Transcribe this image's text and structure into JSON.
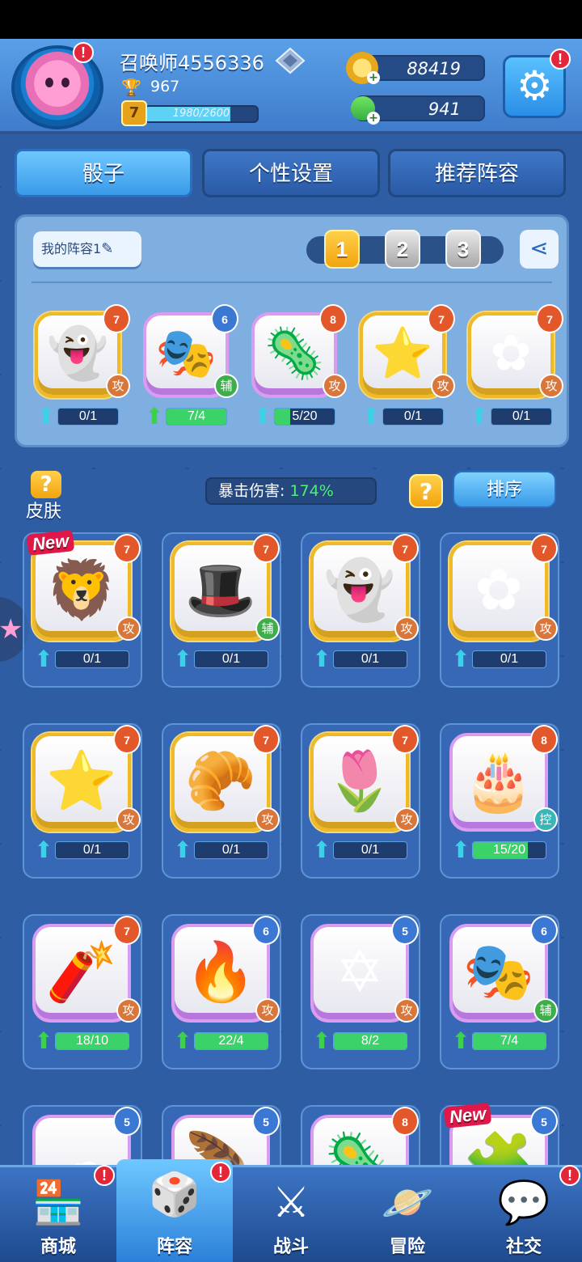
{
  "header": {
    "player_name": "召唤师4556336",
    "trophies": "967",
    "level": "7",
    "xp_text": "1980/2600",
    "xp_fraction": 0.76,
    "gold": "88419",
    "gems": "941",
    "badge": "!"
  },
  "tabs": [
    {
      "label": "骰子",
      "active": true
    },
    {
      "label": "个性设置",
      "active": false
    },
    {
      "label": "推荐阵容",
      "active": false
    }
  ],
  "deck": {
    "name": "我的阵容1",
    "slots": [
      "1",
      "2",
      "3"
    ],
    "active_slot": "1",
    "cards": [
      {
        "icon": "ghost-icon",
        "glyph": "👻",
        "level": "7",
        "level_color": "orange",
        "role": "攻",
        "role_type": "atk",
        "frame": "gold",
        "progress": "0/1",
        "fill": 0,
        "arrow": "cyan"
      },
      {
        "icon": "masks-icon",
        "glyph": "🎭",
        "level": "6",
        "level_color": "blue",
        "role": "辅",
        "role_type": "sup",
        "frame": "purple",
        "progress": "7/4",
        "fill": 1,
        "arrow": "green"
      },
      {
        "icon": "virus-icon",
        "glyph": "🦠",
        "level": "8",
        "level_color": "orange",
        "role": "攻",
        "role_type": "atk",
        "frame": "purple",
        "progress": "5/20",
        "fill": 0.25,
        "arrow": "cyan"
      },
      {
        "icon": "star-icon",
        "glyph": "⭐",
        "level": "7",
        "level_color": "orange",
        "role": "攻",
        "role_type": "atk",
        "frame": "gold",
        "progress": "0/1",
        "fill": 0,
        "arrow": "cyan"
      },
      {
        "icon": "flower-icon",
        "glyph": "✿",
        "level": "7",
        "level_color": "orange",
        "role": "攻",
        "role_type": "atk",
        "frame": "gold",
        "progress": "0/1",
        "fill": 0,
        "arrow": "cyan"
      }
    ]
  },
  "controls": {
    "skin_label": "皮肤",
    "skin_q": "?",
    "crit_label": "暴击伤害:",
    "crit_value": "174%",
    "help": "?",
    "sort_label": "排序"
  },
  "collection": [
    {
      "icon": "lion-icon",
      "glyph": "🦁",
      "level": "7",
      "level_color": "orange",
      "role": "攻",
      "role_type": "atk",
      "frame": "gold",
      "progress": "0/1",
      "fill": 0,
      "arrow": "cyan",
      "new": "New"
    },
    {
      "icon": "witch-hat-icon",
      "glyph": "🎩",
      "level": "7",
      "level_color": "orange",
      "role": "辅",
      "role_type": "sup",
      "frame": "gold",
      "progress": "0/1",
      "fill": 0,
      "arrow": "cyan",
      "new": ""
    },
    {
      "icon": "ghost-icon",
      "glyph": "👻",
      "level": "7",
      "level_color": "orange",
      "role": "攻",
      "role_type": "atk",
      "frame": "gold",
      "progress": "0/1",
      "fill": 0,
      "arrow": "cyan",
      "new": ""
    },
    {
      "icon": "flower-icon",
      "glyph": "✿",
      "level": "7",
      "level_color": "orange",
      "role": "攻",
      "role_type": "atk",
      "frame": "gold",
      "progress": "0/1",
      "fill": 0,
      "arrow": "cyan",
      "new": ""
    },
    {
      "icon": "star-icon",
      "glyph": "⭐",
      "level": "7",
      "level_color": "orange",
      "role": "攻",
      "role_type": "atk",
      "frame": "gold",
      "progress": "0/1",
      "fill": 0,
      "arrow": "cyan",
      "new": ""
    },
    {
      "icon": "bread-icon",
      "glyph": "🥐",
      "level": "7",
      "level_color": "orange",
      "role": "攻",
      "role_type": "atk",
      "frame": "gold",
      "progress": "0/1",
      "fill": 0,
      "arrow": "cyan",
      "new": ""
    },
    {
      "icon": "tulip-icon",
      "glyph": "🌷",
      "level": "7",
      "level_color": "orange",
      "role": "攻",
      "role_type": "atk",
      "frame": "gold",
      "progress": "0/1",
      "fill": 0,
      "arrow": "cyan",
      "new": ""
    },
    {
      "icon": "cake-icon",
      "glyph": "🎂",
      "level": "8",
      "level_color": "orange",
      "role": "控",
      "role_type": "ctl",
      "frame": "purple",
      "progress": "15/20",
      "fill": 0.75,
      "arrow": "cyan",
      "new": ""
    },
    {
      "icon": "firecracker-icon",
      "glyph": "🧨",
      "level": "7",
      "level_color": "orange",
      "role": "攻",
      "role_type": "atk",
      "frame": "purple",
      "progress": "18/10",
      "fill": 1,
      "arrow": "green",
      "new": ""
    },
    {
      "icon": "fire-icon",
      "glyph": "🔥",
      "level": "6",
      "level_color": "blue",
      "role": "攻",
      "role_type": "atk",
      "frame": "purple",
      "progress": "22/4",
      "fill": 1,
      "arrow": "green",
      "new": ""
    },
    {
      "icon": "hexagram-icon",
      "glyph": "✡",
      "level": "5",
      "level_color": "blue",
      "role": "攻",
      "role_type": "atk",
      "frame": "purple",
      "progress": "8/2",
      "fill": 1,
      "arrow": "green",
      "new": ""
    },
    {
      "icon": "masks-icon",
      "glyph": "🎭",
      "level": "6",
      "level_color": "blue",
      "role": "辅",
      "role_type": "sup",
      "frame": "purple",
      "progress": "7/4",
      "fill": 1,
      "arrow": "green",
      "new": ""
    },
    {
      "icon": "cloud-icon",
      "glyph": "☁",
      "level": "5",
      "level_color": "blue",
      "role": "",
      "role_type": "",
      "frame": "purple",
      "progress": "",
      "fill": 0,
      "arrow": "",
      "new": ""
    },
    {
      "icon": "feather-icon",
      "glyph": "🪶",
      "level": "5",
      "level_color": "blue",
      "role": "",
      "role_type": "",
      "frame": "purple",
      "progress": "",
      "fill": 0,
      "arrow": "",
      "new": ""
    },
    {
      "icon": "virus-icon",
      "glyph": "🦠",
      "level": "8",
      "level_color": "orange",
      "role": "",
      "role_type": "",
      "frame": "purple",
      "progress": "",
      "fill": 0,
      "arrow": "",
      "new": ""
    },
    {
      "icon": "puzzle-icon",
      "glyph": "🧩",
      "level": "5",
      "level_color": "blue",
      "role": "",
      "role_type": "",
      "frame": "purple",
      "progress": "",
      "fill": 0,
      "arrow": "",
      "new": "New"
    }
  ],
  "nav": [
    {
      "label": "商城",
      "icon": "shop-icon",
      "glyph": "🏪",
      "badge": "!",
      "active": false
    },
    {
      "label": "阵容",
      "icon": "dice-icon",
      "glyph": "🎲",
      "badge": "!",
      "active": true
    },
    {
      "label": "战斗",
      "icon": "swords-icon",
      "glyph": "⚔",
      "badge": "",
      "active": false
    },
    {
      "label": "冒险",
      "icon": "planet-icon",
      "glyph": "🪐",
      "badge": "",
      "active": false
    },
    {
      "label": "社交",
      "icon": "chat-icon",
      "glyph": "💬",
      "badge": "!",
      "active": false
    }
  ],
  "colors": {
    "accent": "#3a9ae8",
    "gold": "#f2a40f",
    "green": "#3bd26a"
  }
}
